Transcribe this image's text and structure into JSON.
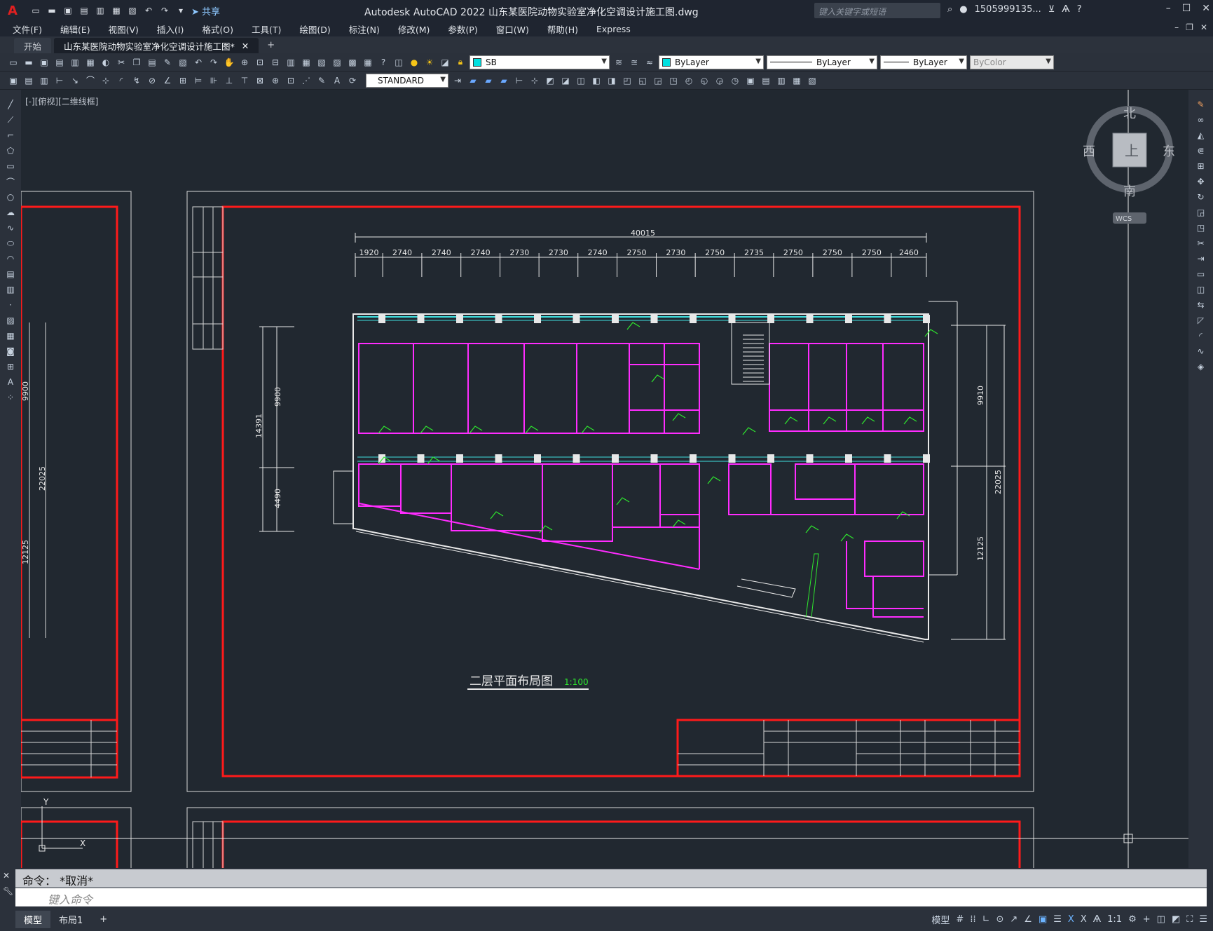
{
  "window": {
    "app_logo": "A",
    "title": "Autodesk AutoCAD 2022    山东某医院动物实验室净化空调设计施工图.dwg",
    "share_label": "共享",
    "search_placeholder": "键入关键字或短语",
    "user": "1505999135...",
    "controls": [
      "–",
      "☐",
      "✕"
    ]
  },
  "menu": [
    "文件(F)",
    "编辑(E)",
    "视图(V)",
    "插入(I)",
    "格式(O)",
    "工具(T)",
    "绘图(D)",
    "标注(N)",
    "修改(M)",
    "参数(P)",
    "窗口(W)",
    "帮助(H)",
    "Express"
  ],
  "tabs": [
    {
      "label": "开始"
    },
    {
      "label": "山东某医院动物实验室净化空调设计施工图*"
    }
  ],
  "toolbar1": {
    "layer": "SB",
    "color": "ByLayer",
    "linetype": "ByLayer",
    "lineweight": "ByLayer",
    "plotstyle": "ByColor"
  },
  "toolbar2": {
    "textstyle": "STANDARD"
  },
  "view": {
    "label": "[-][俯视][二维线框]",
    "compass": {
      "north": "北",
      "south": "南",
      "east": "东",
      "west": "西",
      "top": "上"
    },
    "wcs": "WCS"
  },
  "drawing": {
    "title": "二层平面布局图",
    "scale": "1:100",
    "total_dim": "40015",
    "top_dims": [
      "1920",
      "2740",
      "2740",
      "2740",
      "2730",
      "2730",
      "2740",
      "2750",
      "2730",
      "2750",
      "2735",
      "2750",
      "2750",
      "2750",
      "2460"
    ],
    "left_dims": [
      "9900",
      "4490",
      "14391"
    ],
    "right_dims": [
      "9910",
      "12125",
      "22025"
    ],
    "left_frame_dims": [
      "9900",
      "22025",
      "12125"
    ]
  },
  "command": {
    "history": "命令：  *取消*",
    "placeholder": "键入命令"
  },
  "status": {
    "tabs": [
      "模型",
      "布局1"
    ],
    "model_label": "模型",
    "scale": "1:1"
  }
}
